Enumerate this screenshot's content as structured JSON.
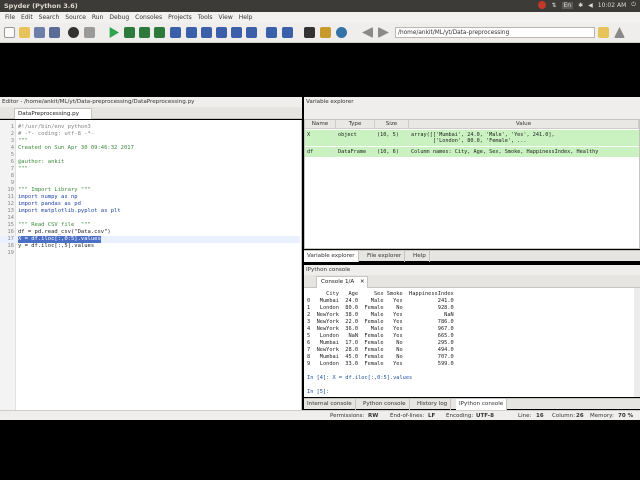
{
  "window": {
    "title": "Spyder (Python 3.6)"
  },
  "tray": {
    "keyboard": "En",
    "time": "10:02 AM"
  },
  "menu": [
    "File",
    "Edit",
    "Search",
    "Source",
    "Run",
    "Debug",
    "Consoles",
    "Projects",
    "Tools",
    "View",
    "Help"
  ],
  "toolbar": {
    "working_dir": "/home/ankit/ML/yt/Data-preprocessing"
  },
  "editor": {
    "pane_title": "Editor - /home/ankit/ML/yt/Data-preprocessing/DataPreprocessing.py",
    "tab_label": "DataPreprocessing.py",
    "lines": [
      "#!/usr/bin/env python3",
      "# -*- coding: utf-8 -*-",
      "\"\"\"",
      "Created on Sun Apr 30 09:46:32 2017",
      "",
      "@author: ankit",
      "\"\"\"",
      "",
      "",
      "\"\"\" Import Library \"\"\"",
      "import numpy as np",
      "import pandas as pd",
      "import matplotlib.pyplot as plt",
      "",
      "\"\"\" Read CSV file  \"\"\"",
      "df = pd.read_csv(\"Data.csv\")",
      "X = df.iloc[:,0:5].values",
      "y = df.iloc[:,5].values",
      ""
    ],
    "current_line": 17
  },
  "variable_explorer": {
    "pane_title": "Variable explorer",
    "columns": [
      "Name",
      "Type",
      "Size",
      "Value"
    ],
    "rows": [
      {
        "name": "X",
        "type": "object",
        "size": "(10, 5)",
        "value": "array([['Mumbai', 24.0, 'Male', 'Yes', 241.0],\n       ['London', 80.0, 'Female', ..."
      },
      {
        "name": "df",
        "type": "DataFrame",
        "size": "(10, 6)",
        "value": "Column names: City, Age, Sex, Smoke, HappinessIndex, Healthy"
      }
    ],
    "tabs": [
      "Variable explorer",
      "File explorer",
      "Help"
    ]
  },
  "ipython": {
    "pane_title": "IPython console",
    "tab_label": "Console 1/A",
    "header": "      City   Age     Sex Smoke  HappinessIndex",
    "table": [
      "0   Mumbai  24.0    Male   Yes           241.0",
      "1   London  80.0  Female    No           928.0",
      "2  NewYork  38.0    Male   Yes             NaN",
      "3  NewYork  22.0  Female   Yes           786.0",
      "4  NewYork  36.0    Male   Yes           967.0",
      "5   London   NaN  Female   Yes           665.0",
      "6   Mumbai  17.0  Female    No           295.0",
      "7  NewYork  28.0  Female    No           494.0",
      "8   Mumbai  45.0  Female    No           707.0",
      "9   London  33.0  Female   Yes           599.0"
    ],
    "input_4": "In [4]: X = df.iloc[:,0:5].values",
    "input_5": "In [5]:",
    "bottom_tabs": [
      "Internal console",
      "Python console",
      "History log",
      "IPython console"
    ]
  },
  "status": {
    "permissions_label": "Permissions:",
    "permissions": "RW",
    "eol_label": "End-of-lines:",
    "eol": "LF",
    "encoding_label": "Encoding:",
    "encoding": "UTF-8",
    "line_label": "Line:",
    "line": "16",
    "column_label": "Column:",
    "column": "26",
    "memory_label": "Memory:",
    "memory": "70 %"
  },
  "colors": {
    "selection": "#4a6fc7",
    "var_row": "#c9f2c0",
    "menu_bg": "#f2f1f0",
    "top_bar": "#3c3b37"
  }
}
